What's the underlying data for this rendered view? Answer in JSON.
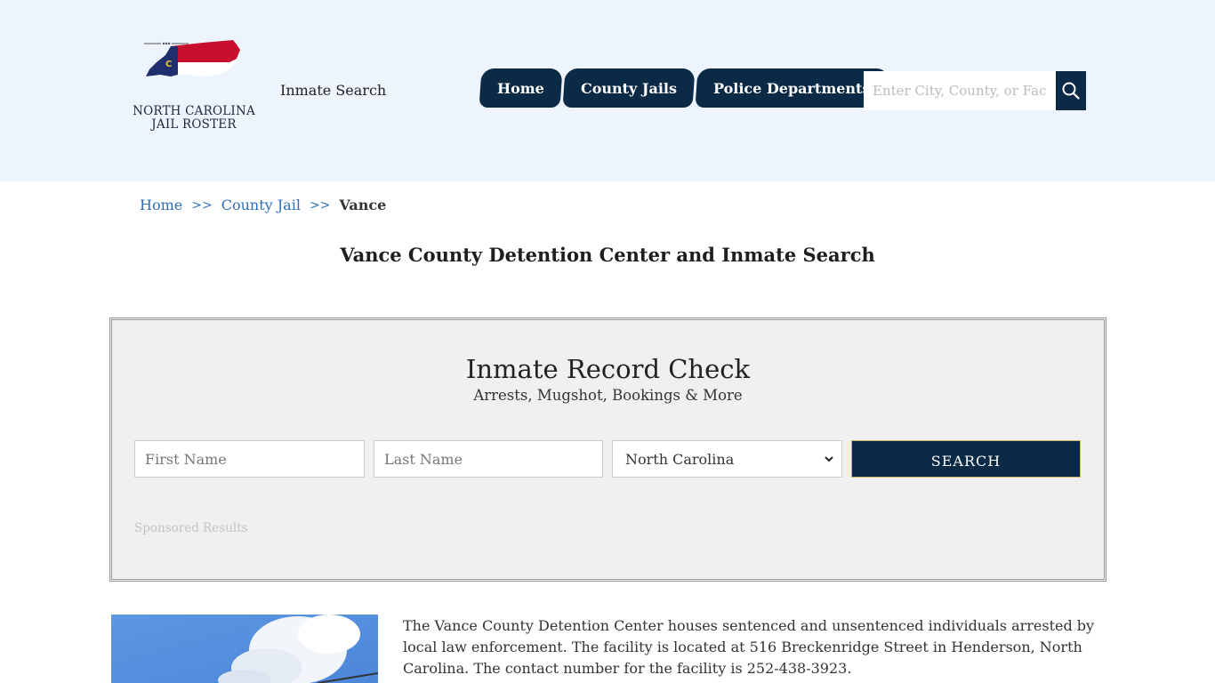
{
  "header": {
    "logo": {
      "line1": "NORTH CAROLINA",
      "line2": "JAIL ROSTER",
      "icon": "nc-flag-map-icon"
    },
    "brand_link": "Inmate Search",
    "nav": [
      {
        "label": "Home"
      },
      {
        "label": "County Jails"
      },
      {
        "label": "Police Departments"
      }
    ],
    "search": {
      "placeholder": "Enter City, County, or Facility",
      "icon": "search-icon"
    }
  },
  "breadcrumb": {
    "items": [
      {
        "label": "Home"
      },
      {
        "label": "County Jail"
      }
    ],
    "separator": ">>",
    "current": "Vance"
  },
  "page_title": "Vance County Detention Center and Inmate Search",
  "record_check": {
    "title": "Inmate Record Check",
    "subtitle": "Arrests, Mugshot, Bookings & More",
    "first_name_placeholder": "First Name",
    "last_name_placeholder": "Last Name",
    "state_selected": "North Carolina",
    "search_label": "SEARCH",
    "sponsored": "Sponsored Results"
  },
  "content": {
    "photo_icon": "facility-photo",
    "description": "The Vance County Detention Center houses sentenced and unsentenced individuals arrested by local law enforcement. The facility is located at 516 Breckenridge Street in Henderson, North Carolina. The contact number for the facility is 252-438-3923."
  },
  "colors": {
    "navy": "#0b2a45",
    "header_bg": "#eef4fd",
    "link": "#2f6fb7",
    "panel_bg": "#f0f0f0"
  }
}
